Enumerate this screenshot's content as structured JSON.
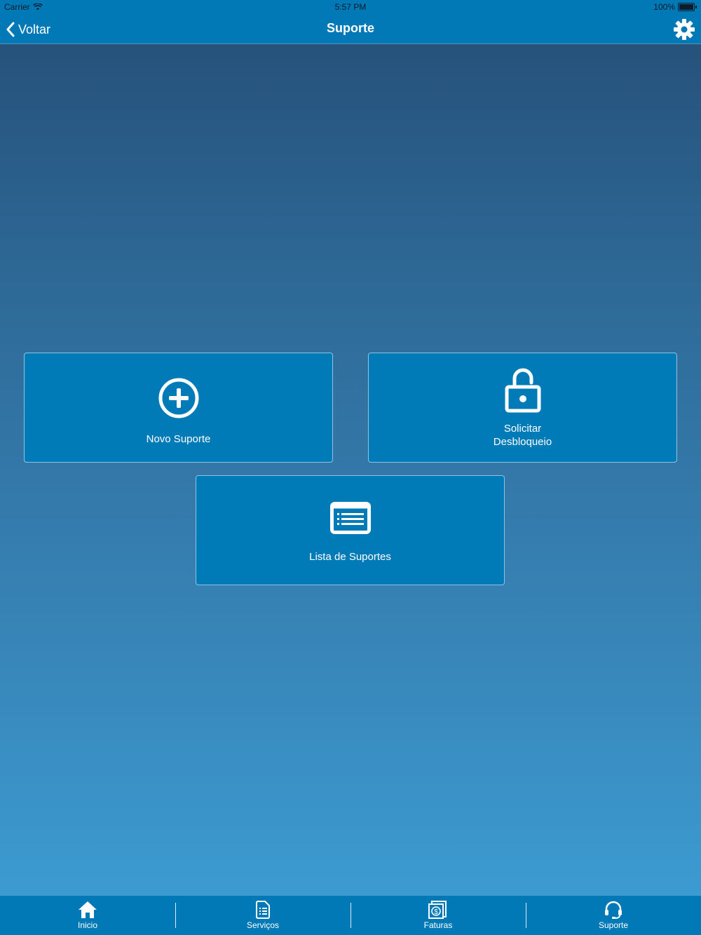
{
  "status_bar": {
    "carrier": "Carrier",
    "time": "5:57 PM",
    "battery": "100%"
  },
  "nav": {
    "back_label": "Voltar",
    "title": "Suporte"
  },
  "tiles": {
    "novo_suporte": "Novo Suporte",
    "solicitar_line1": "Solicitar",
    "solicitar_line2": "Desbloqueio",
    "lista_suportes": "Lista de Suportes"
  },
  "tabs": [
    {
      "label": "Inicio",
      "icon": "home-icon"
    },
    {
      "label": "Serviços",
      "icon": "document-icon"
    },
    {
      "label": "Faturas",
      "icon": "invoice-icon"
    },
    {
      "label": "Suporte",
      "icon": "headset-icon"
    }
  ],
  "colors": {
    "bar": "#0079b6",
    "tile": "#007bb8",
    "bg_top": "#26527b",
    "bg_bottom": "#3c9bd1"
  }
}
